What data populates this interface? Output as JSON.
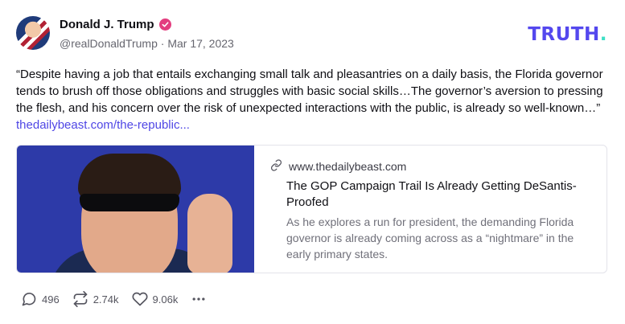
{
  "author": {
    "display_name": "Donald J. Trump",
    "handle": "@realDonaldTrump",
    "date": "Mar 17, 2023",
    "separator": "·"
  },
  "brand": {
    "logo_text": "TRUTH",
    "logo_dot": ".",
    "color": "#5448ee",
    "dot_color": "#3de0c6"
  },
  "post": {
    "text": "“Despite having a job that entails exchanging small talk and pleasantries on a daily basis, the Florida governor tends to brush off those obligations and struggles with basic social skills…The governor’s aversion to pressing the flesh, and his concern over the risk of unexpected interactions with the public, is already so well-known…”",
    "link_text": "thedailybeast.com/the-republic..."
  },
  "card": {
    "domain": "www.thedailybeast.com",
    "title": "The GOP Campaign Trail Is Already Getting DeSantis-Proofed",
    "description": "As he explores a run for president, the demanding Florida governor is already coming across as a “nightmare” in the early primary states.",
    "link_icon": "link-icon"
  },
  "actions": {
    "replies": "496",
    "retruths": "2.74k",
    "likes": "9.06k",
    "more_icon": "ellipsis-icon"
  }
}
